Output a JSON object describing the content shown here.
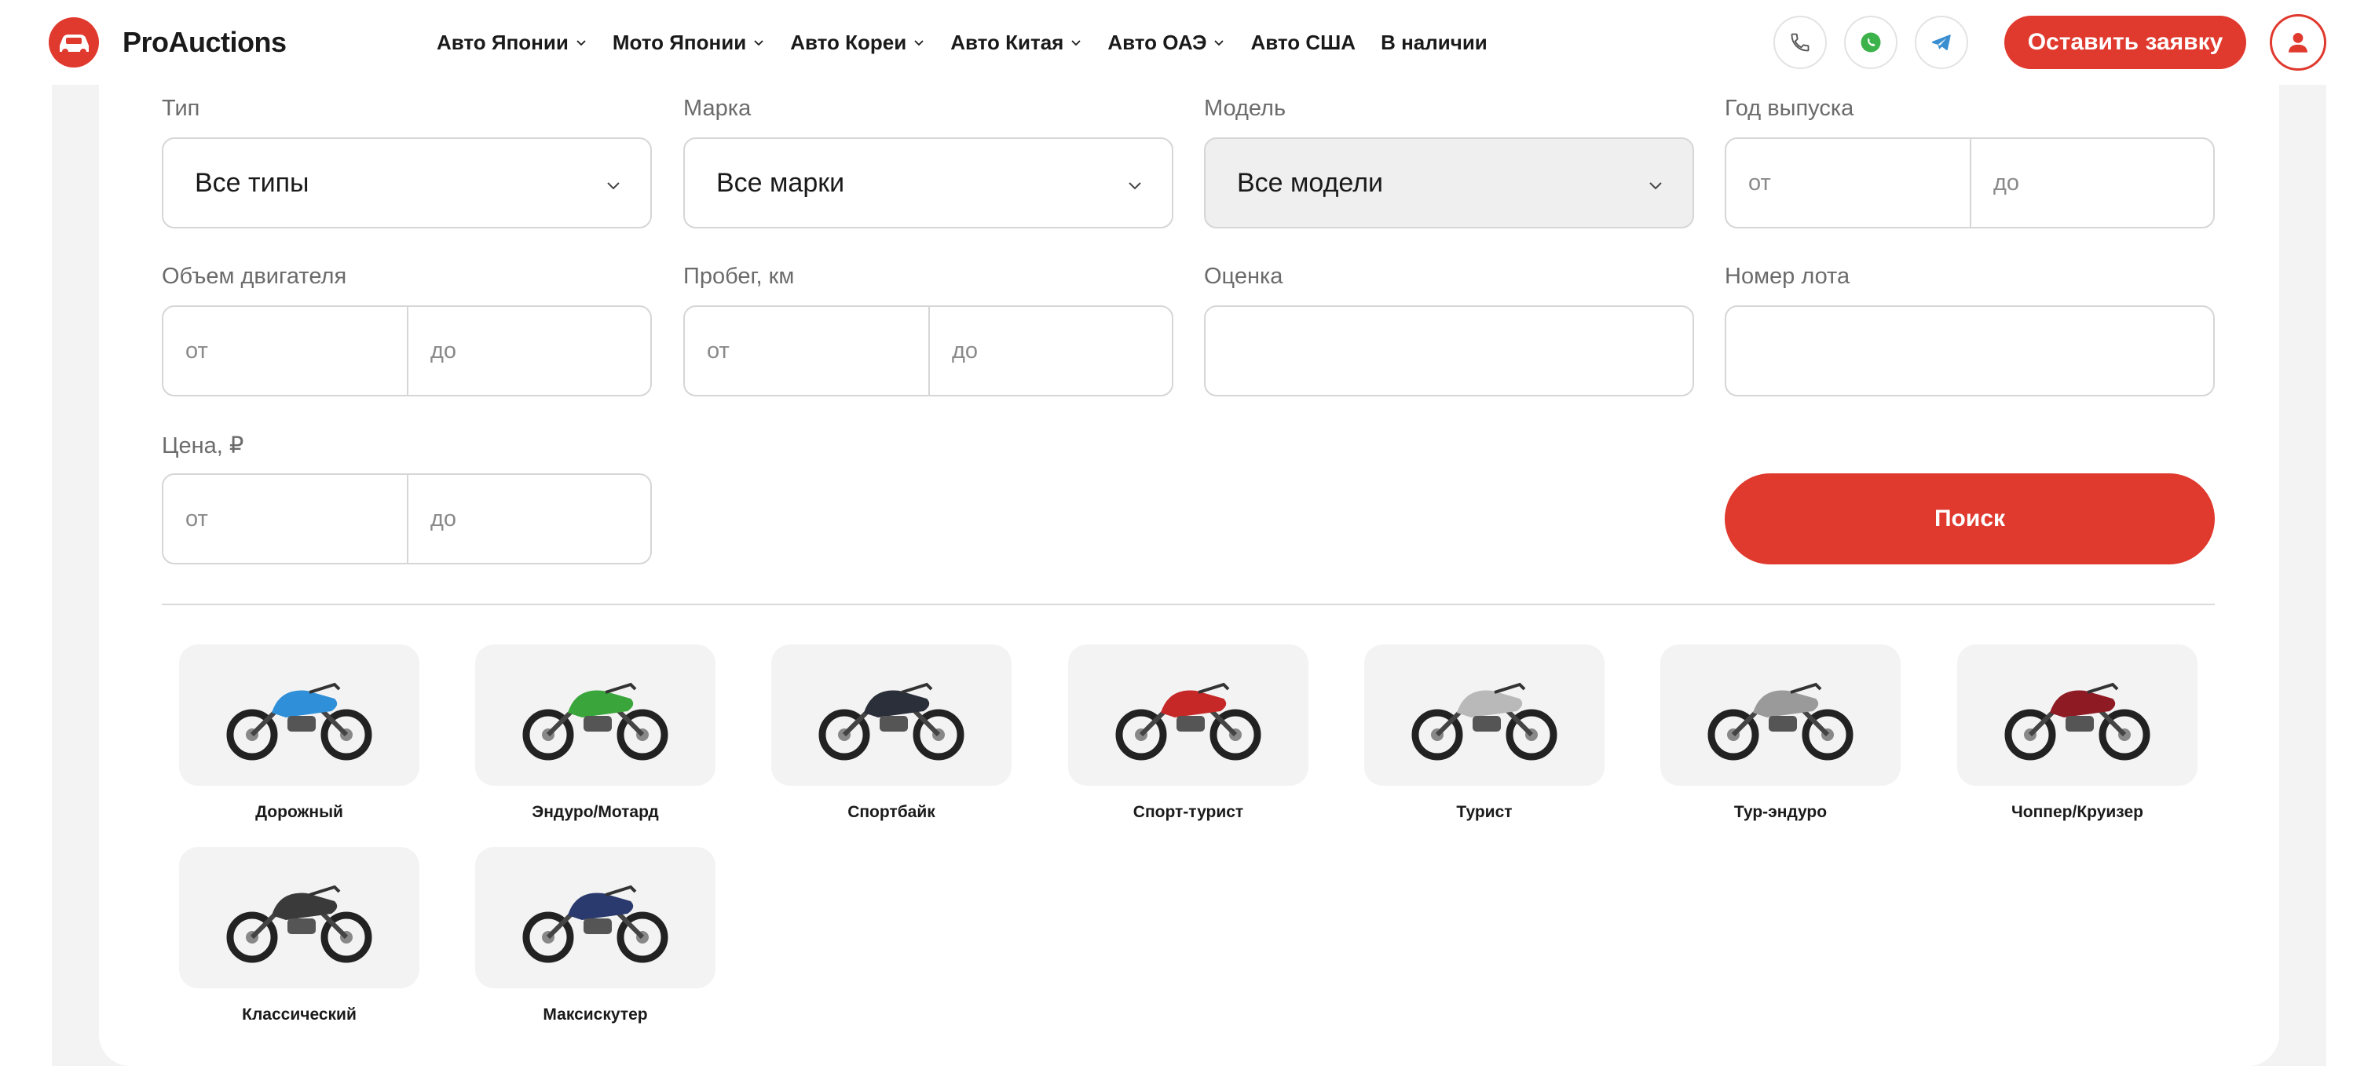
{
  "header": {
    "logo_text": "ProAuctions",
    "nav": [
      {
        "label": "Авто Японии",
        "has_dropdown": true
      },
      {
        "label": "Мото Японии",
        "has_dropdown": true
      },
      {
        "label": "Авто Кореи",
        "has_dropdown": true
      },
      {
        "label": "Авто Китая",
        "has_dropdown": true
      },
      {
        "label": "Авто ОАЭ",
        "has_dropdown": true
      },
      {
        "label": "Авто США",
        "has_dropdown": false
      },
      {
        "label": "В наличии",
        "has_dropdown": false
      }
    ],
    "contact_icons": [
      "phone-icon",
      "whatsapp-icon",
      "telegram-icon"
    ],
    "cta_label": "Оставить заявку",
    "user_icon": "user-icon"
  },
  "filters": {
    "type": {
      "label": "Тип",
      "value": "Все типы"
    },
    "brand": {
      "label": "Марка",
      "value": "Все марки"
    },
    "model": {
      "label": "Модель",
      "value": "Все модели"
    },
    "year": {
      "label": "Год выпуска",
      "from_placeholder": "от",
      "to_placeholder": "до"
    },
    "engine": {
      "label": "Объем двигателя",
      "from_placeholder": "от",
      "to_placeholder": "до"
    },
    "mileage": {
      "label": "Пробег, км",
      "from_placeholder": "от",
      "to_placeholder": "до"
    },
    "grade": {
      "label": "Оценка",
      "value": ""
    },
    "lot": {
      "label": "Номер лота",
      "value": ""
    },
    "price": {
      "label": "Цена, ₽",
      "from_placeholder": "от",
      "to_placeholder": "до"
    },
    "search_label": "Поиск"
  },
  "categories": [
    {
      "label": "Дорожный",
      "color": "#2f8fd8"
    },
    {
      "label": "Эндуро/Мотард",
      "color": "#3aa53a"
    },
    {
      "label": "Спортбайк",
      "color": "#2b2f3a"
    },
    {
      "label": "Спорт-турист",
      "color": "#c62828"
    },
    {
      "label": "Турист",
      "color": "#b9b9b9"
    },
    {
      "label": "Тур-эндуро",
      "color": "#9a9a9a"
    },
    {
      "label": "Чоппер/Круизер",
      "color": "#8e1b24"
    },
    {
      "label": "Классический",
      "color": "#3a3a3a"
    },
    {
      "label": "Максискутер",
      "color": "#2a3a6e"
    }
  ],
  "colors": {
    "accent": "#e0392e",
    "border": "#d6d6d6",
    "muted": "#6b6b6b"
  }
}
